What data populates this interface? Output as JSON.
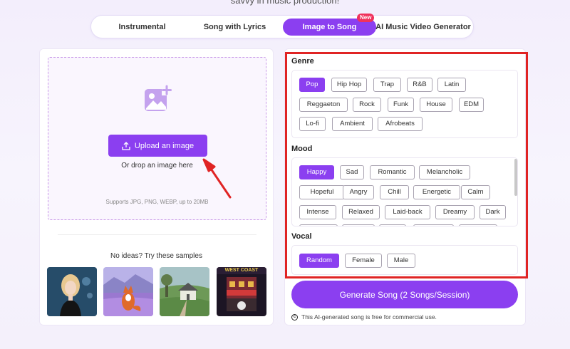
{
  "header": {
    "subtitle": "savvy in music production!"
  },
  "tabs": [
    {
      "label": "Instrumental"
    },
    {
      "label": "Song with Lyrics"
    },
    {
      "label": "Image to Song",
      "badge": "New"
    },
    {
      "label": "AI Music Video Generator"
    }
  ],
  "upload": {
    "button_label": "Upload an image",
    "drop_text": "Or drop an image here",
    "supports": "Supports JPG, PNG, WEBP, up to 20MB"
  },
  "samples": {
    "title": "No ideas? Try these samples",
    "items": [
      {
        "icon": "woman-portrait"
      },
      {
        "icon": "fox-lavender"
      },
      {
        "icon": "house-landscape"
      },
      {
        "icon": "west-coast-poster",
        "text": "WEST COAST"
      }
    ]
  },
  "genre": {
    "title": "Genre",
    "options": [
      "Pop",
      "Hip Hop",
      "Trap",
      "R&B",
      "Latin",
      "Reggaeton",
      "Rock",
      "Funk",
      "House",
      "EDM",
      "Lo-fi",
      "Ambient",
      "Afrobeats"
    ],
    "selected": "Pop"
  },
  "mood": {
    "title": "Mood",
    "options": [
      "Happy",
      "Sad",
      "Romantic",
      "Melancholic",
      "Hopeful",
      "Angry",
      "Chill",
      "Energetic",
      "Calm",
      "Intense",
      "Relaxed",
      "Laid-back",
      "Dreamy",
      "Dark"
    ],
    "selected": "Happy"
  },
  "vocal": {
    "title": "Vocal",
    "options": [
      "Random",
      "Female",
      "Male"
    ],
    "selected": "Random"
  },
  "generate": {
    "label": "Generate Song (2 Songs/Session)"
  },
  "license": {
    "text": "This AI-generated song is free for commercial use."
  },
  "colors": {
    "accent": "#8b3ff0",
    "highlight": "#e02424",
    "badge": "#f0325c"
  }
}
